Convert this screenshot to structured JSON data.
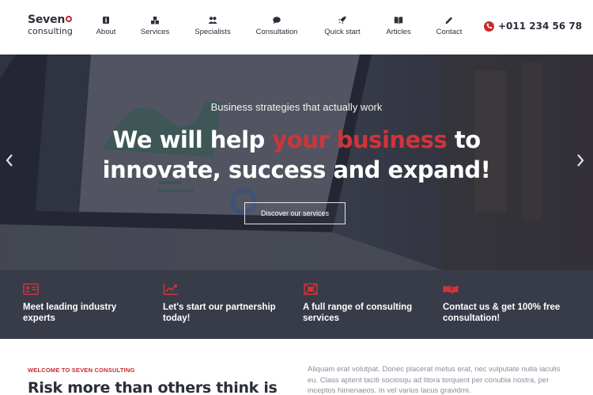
{
  "brand": {
    "name": "Seven",
    "tagline": "consulting"
  },
  "nav": {
    "items": [
      {
        "label": "About",
        "icon": "info-icon"
      },
      {
        "label": "Services",
        "icon": "blocks-icon"
      },
      {
        "label": "Specialists",
        "icon": "users-icon"
      },
      {
        "label": "Consultation",
        "icon": "chat-icon"
      },
      {
        "label": "Quick start",
        "icon": "rocket-icon"
      },
      {
        "label": "Articles",
        "icon": "book-icon"
      },
      {
        "label": "Contact",
        "icon": "pencil-icon"
      }
    ]
  },
  "phone": {
    "number": "+011 234 56 78",
    "icon": "phone-icon"
  },
  "hero": {
    "subtitle": "Business strategies that actually work",
    "title_part1": "We will help ",
    "title_highlight": "your business",
    "title_part2": " to",
    "title_line2": "innovate, success and expand!",
    "button_label": "Discover our services"
  },
  "features": [
    {
      "text": "Meet leading industry experts",
      "icon": "id-card-icon"
    },
    {
      "text": "Let's start our partnership today!",
      "icon": "trend-chart-icon"
    },
    {
      "text": "A full range of consulting services",
      "icon": "target-icon"
    },
    {
      "text": "Contact us & get 100% free consultation!",
      "icon": "handshake-icon"
    }
  ],
  "about": {
    "eyebrow": "Welcome to Seven Consulting",
    "title": "Risk more than others think is",
    "body": "Aliquam erat volutpat. Donec placerat metus erat, nec vulputate nulla iaculis eu. Class aptent taciti sociosqu ad litora torquent per conubia nostra, per inceptos himenaeos. In vel varius lacus gravidmi."
  },
  "colors": {
    "accent": "#c8282e",
    "dark": "#383c48",
    "text": "#2b2f3a"
  }
}
